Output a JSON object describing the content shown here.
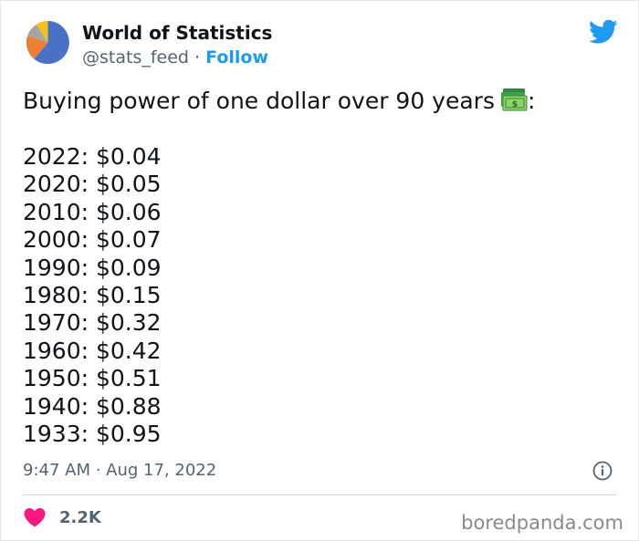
{
  "author": {
    "name": "World of Statistics",
    "handle": "@stats_feed",
    "separator": "·",
    "follow_label": "Follow",
    "avatar_icon": "pie-chart-avatar"
  },
  "brand_icon": "twitter-bird-icon",
  "colors": {
    "twitter_blue": "#1d9bf0",
    "text_primary": "#0f1419",
    "text_secondary": "#536471",
    "like_pink": "#f91880"
  },
  "tweet": {
    "intro_text": "Buying power of one dollar over 90 years",
    "intro_suffix": ":",
    "intro_emoji": "money-bill-emoji",
    "items": [
      "2022: $0.04",
      "2020: $0.05",
      "2010: $0.06",
      "2000: $0.07",
      "1990: $0.09",
      "1980: $0.15",
      "1970: $0.32",
      "1960: $0.42",
      "1950: $0.51",
      "1940: $0.88",
      "1933: $0.95"
    ]
  },
  "meta": {
    "timestamp": "9:47 AM · Aug 17, 2022",
    "info_icon": "info-icon"
  },
  "engagement": {
    "like_icon": "heart-icon",
    "like_count": "2.2K"
  },
  "watermark": "boredpanda.com"
}
